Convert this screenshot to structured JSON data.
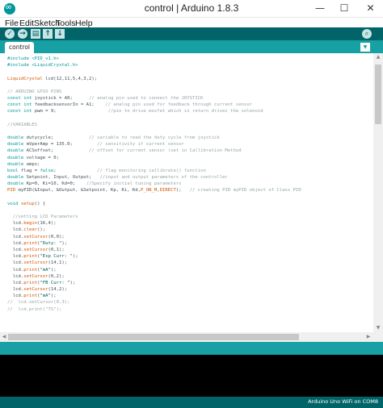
{
  "window": {
    "title": "control | Arduino 1.8.3",
    "minimize_glyph": "—",
    "maximize_glyph": "☐",
    "close_glyph": "✕"
  },
  "menu": {
    "file": "File",
    "edit": "Edit",
    "sketch": "Sketch",
    "tools": "Tools",
    "help": "Help"
  },
  "toolbar": {
    "verify_glyph": "✓",
    "upload_glyph": "→",
    "new_glyph": "▤",
    "open_glyph": "↑",
    "save_glyph": "↓",
    "serial_glyph": "⌕"
  },
  "tabs": {
    "active": "control",
    "menu_glyph": "▼"
  },
  "code_lines": [
    [
      {
        "t": "#include <PID_v1.h>",
        "c": "kw"
      }
    ],
    [
      {
        "t": "#include <LiquidCrystal.h>",
        "c": "kw"
      }
    ],
    [],
    [
      {
        "t": "LiquidCrystal",
        "c": "fn"
      },
      {
        "t": " lcd(12,11,5,4,3,2);"
      }
    ],
    [],
    [
      {
        "t": "// ARDUINO GPIO PINS",
        "c": "cm"
      }
    ],
    [
      {
        "t": "const",
        "c": "kw"
      },
      {
        "t": " "
      },
      {
        "t": "int",
        "c": "kw"
      },
      {
        "t": " joystick = A0;      "
      },
      {
        "t": "// analog pin used to connect the JOYSTICK",
        "c": "cm"
      }
    ],
    [
      {
        "t": "const",
        "c": "kw"
      },
      {
        "t": " "
      },
      {
        "t": "int",
        "c": "kw"
      },
      {
        "t": " feedbacksensorIn = A1;    "
      },
      {
        "t": "// analog pin used for feedback through current sensor",
        "c": "cm"
      }
    ],
    [
      {
        "t": "const",
        "c": "kw"
      },
      {
        "t": " "
      },
      {
        "t": "int",
        "c": "kw"
      },
      {
        "t": " pwm = 9;                   "
      },
      {
        "t": "//pin to drive mosfet which in return drives the solenoid",
        "c": "cm"
      }
    ],
    [],
    [
      {
        "t": "//VARIABLES",
        "c": "cm"
      }
    ],
    [],
    [
      {
        "t": "double",
        "c": "kw"
      },
      {
        "t": " dutycycle;             "
      },
      {
        "t": "// variable to read the duty cycle from joystick",
        "c": "cm"
      }
    ],
    [
      {
        "t": "double",
        "c": "kw"
      },
      {
        "t": " mVperAmp = 135.0;         "
      },
      {
        "t": "// sensitivity if current sensor",
        "c": "cm"
      }
    ],
    [
      {
        "t": "double",
        "c": "kw"
      },
      {
        "t": " ACSoffset;             "
      },
      {
        "t": "// offset for current sensor (set in Callibration Method",
        "c": "cm"
      }
    ],
    [
      {
        "t": "double",
        "c": "kw"
      },
      {
        "t": " voltage = 0;"
      }
    ],
    [
      {
        "t": "double",
        "c": "kw"
      },
      {
        "t": " amps;"
      }
    ],
    [
      {
        "t": "bool",
        "c": "kw"
      },
      {
        "t": " flag = "
      },
      {
        "t": "false",
        "c": "kw"
      },
      {
        "t": ";               "
      },
      {
        "t": "// flag monitoring callibrate() function",
        "c": "cm"
      }
    ],
    [
      {
        "t": "double",
        "c": "kw"
      },
      {
        "t": " Setpoint, Input, Output;   "
      },
      {
        "t": "//input and output parameters of the controller",
        "c": "cm"
      }
    ],
    [
      {
        "t": "double",
        "c": "kw"
      },
      {
        "t": " Kp=0, Ki=10, Kd=0;    "
      },
      {
        "t": "//Specify initial tuning parameters",
        "c": "cm"
      }
    ],
    [
      {
        "t": "PID",
        "c": "fn"
      },
      {
        "t": " myPID(&Input, &Output, &Setpoint, Kp, Ki, Kd,"
      },
      {
        "t": "P_ON_M",
        "c": "fn"
      },
      {
        "t": ","
      },
      {
        "t": "DIRECT",
        "c": "fn"
      },
      {
        "t": ");   "
      },
      {
        "t": "// creating PID myPID object of Class PID",
        "c": "cm"
      }
    ],
    [],
    [
      {
        "t": "void",
        "c": "kw"
      },
      {
        "t": " "
      },
      {
        "t": "setup",
        "c": "fn"
      },
      {
        "t": "() {"
      }
    ],
    [],
    [
      {
        "t": "  "
      },
      {
        "t": "//setting LCD Parameters",
        "c": "cm"
      }
    ],
    [
      {
        "t": "  lcd."
      },
      {
        "t": "begin",
        "c": "fn"
      },
      {
        "t": "(16,4);"
      }
    ],
    [
      {
        "t": "  lcd."
      },
      {
        "t": "clear",
        "c": "fn"
      },
      {
        "t": "();"
      }
    ],
    [
      {
        "t": "  lcd."
      },
      {
        "t": "setCursor",
        "c": "fn"
      },
      {
        "t": "(0,0);"
      }
    ],
    [
      {
        "t": "  lcd."
      },
      {
        "t": "print",
        "c": "fn"
      },
      {
        "t": "("
      },
      {
        "t": "\"Duty: \"",
        "c": "st"
      },
      {
        "t": ");"
      }
    ],
    [
      {
        "t": "  lcd."
      },
      {
        "t": "setCursor",
        "c": "fn"
      },
      {
        "t": "(0,1);"
      }
    ],
    [
      {
        "t": "  lcd."
      },
      {
        "t": "print",
        "c": "fn"
      },
      {
        "t": "("
      },
      {
        "t": "\"Exp Curr: \"",
        "c": "st"
      },
      {
        "t": ");"
      }
    ],
    [
      {
        "t": "  lcd."
      },
      {
        "t": "setCursor",
        "c": "fn"
      },
      {
        "t": "(14,1);"
      }
    ],
    [
      {
        "t": "  lcd."
      },
      {
        "t": "print",
        "c": "fn"
      },
      {
        "t": "("
      },
      {
        "t": "\"mA\"",
        "c": "st"
      },
      {
        "t": ");"
      }
    ],
    [
      {
        "t": "  lcd."
      },
      {
        "t": "setCursor",
        "c": "fn"
      },
      {
        "t": "(0,2);"
      }
    ],
    [
      {
        "t": "  lcd."
      },
      {
        "t": "print",
        "c": "fn"
      },
      {
        "t": "("
      },
      {
        "t": "\"FB Curr: \"",
        "c": "st"
      },
      {
        "t": ");"
      }
    ],
    [
      {
        "t": "  lcd."
      },
      {
        "t": "setCursor",
        "c": "fn"
      },
      {
        "t": "(14,2);"
      }
    ],
    [
      {
        "t": "  lcd."
      },
      {
        "t": "print",
        "c": "fn"
      },
      {
        "t": "("
      },
      {
        "t": "\"mA\"",
        "c": "st"
      },
      {
        "t": ");"
      }
    ],
    [
      {
        "t": "//  lcd.setCursor(0,3);",
        "c": "cm"
      }
    ],
    [
      {
        "t": "//  lcd.print(\"TS\");",
        "c": "cm"
      }
    ]
  ],
  "scrollbar": {
    "up": "▲",
    "down": "▼",
    "left": "◀",
    "right": "▶"
  },
  "status": {
    "board": "Arduino Uno WiFi on COM8"
  },
  "colors": {
    "toolbar": "#006468",
    "tabbar": "#17a1a5",
    "keyword": "#00979c",
    "function": "#d35400",
    "comment": "#95a5a6",
    "console": "#000000"
  }
}
